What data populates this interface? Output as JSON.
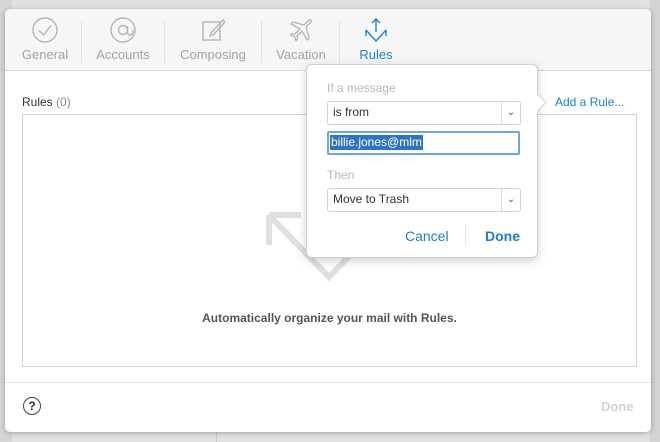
{
  "toolbar": {
    "tabs": [
      {
        "label": "General",
        "icon": "checkmark-circle-icon"
      },
      {
        "label": "Accounts",
        "icon": "at-sign-icon"
      },
      {
        "label": "Composing",
        "icon": "compose-icon"
      },
      {
        "label": "Vacation",
        "icon": "airplane-icon"
      },
      {
        "label": "Rules",
        "icon": "rules-arrows-icon"
      }
    ],
    "active_tab": "Rules"
  },
  "rules": {
    "title": "Rules",
    "count": "(0)",
    "add_rule": "Add a Rule...",
    "empty_message": "Automatically organize your mail with Rules."
  },
  "popover": {
    "if_label": "If a message",
    "condition": "is from",
    "value": "billie.jones@mlm",
    "then_label": "Then",
    "action": "Move to Trash",
    "cancel": "Cancel",
    "done": "Done"
  },
  "footer": {
    "help": "?",
    "done": "Done"
  },
  "colors": {
    "accent": "#1e83d4",
    "selection": "#2f73c6",
    "disabled": "#d2d2d2"
  }
}
